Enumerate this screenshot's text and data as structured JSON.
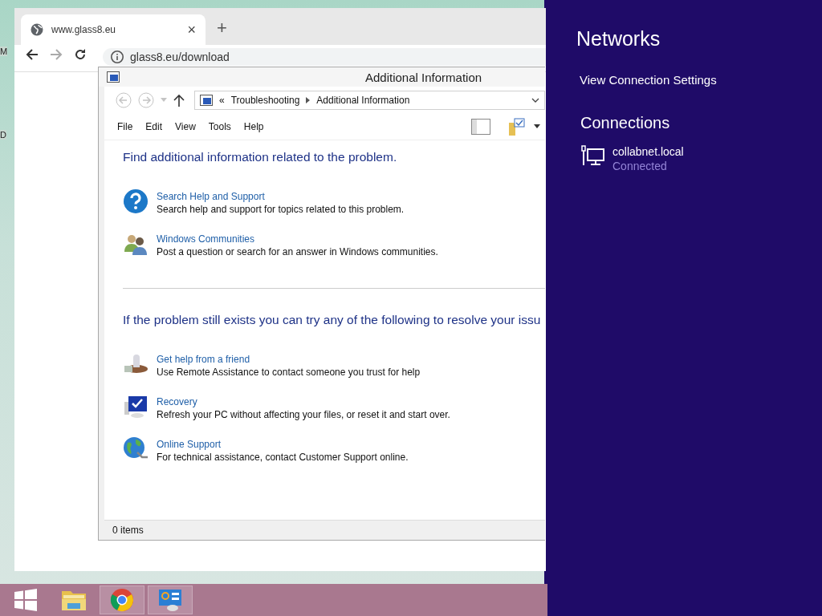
{
  "desktop_icons": [
    {
      "label": "M"
    },
    {
      "label": "D"
    }
  ],
  "browser": {
    "tab_title": "www.glass8.eu",
    "close": "×",
    "new_tab": "+",
    "address": "glass8.eu/download"
  },
  "explorer": {
    "title": "Additional Information",
    "breadcrumb_prefix": "«",
    "breadcrumb": [
      "Troubleshooting",
      "Additional Information"
    ],
    "menu": [
      "File",
      "Edit",
      "View",
      "Tools",
      "Help"
    ],
    "sections": [
      {
        "heading": "Find additional information related to the problem.",
        "items": [
          {
            "kind": "help",
            "link": "Search Help and Support",
            "description": "Search help and support for topics related to this problem."
          },
          {
            "kind": "people",
            "link": "Windows Communities",
            "description": "Post a question or search for an answer in Windows communities."
          }
        ]
      },
      {
        "heading": "If the problem still exists you can try any of the following to resolve your issu",
        "items": [
          {
            "kind": "friend",
            "link": "Get help from a friend",
            "description": "Use Remote Assistance to contact someone you trust for help"
          },
          {
            "kind": "recovery",
            "link": "Recovery",
            "description": "Refresh your PC without affecting your files, or reset it and start over."
          },
          {
            "kind": "globe",
            "link": "Online Support",
            "description": "For technical assistance, contact Customer Support online."
          }
        ]
      }
    ],
    "status": "0 items"
  },
  "charm": {
    "title": "Networks",
    "link": "View Connection Settings",
    "section": "Connections",
    "connections": [
      {
        "name": "collabnet.local",
        "status": "Connected"
      }
    ]
  },
  "taskbar": {
    "items": [
      {
        "kind": "start",
        "running": false
      },
      {
        "kind": "folder",
        "running": false
      },
      {
        "kind": "chrome",
        "running": true
      },
      {
        "kind": "control",
        "running": true
      }
    ]
  }
}
